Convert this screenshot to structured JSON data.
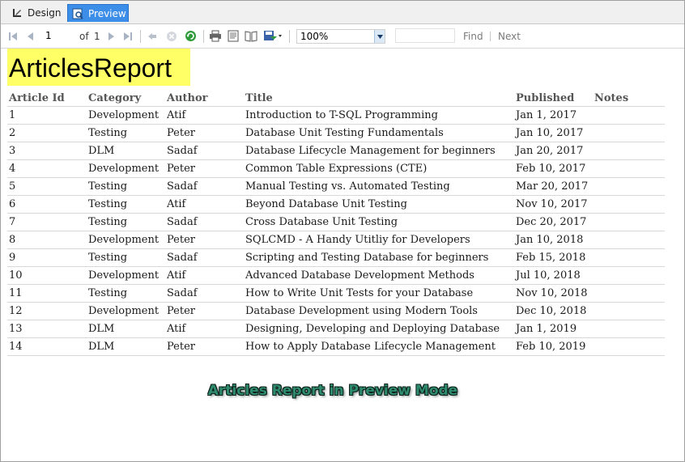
{
  "tabs": {
    "design_label": "Design",
    "preview_label": "Preview"
  },
  "toolbar": {
    "current_page": "1",
    "of_label": "of",
    "total_pages": "1",
    "zoom_value": "100%",
    "find_label": "Find",
    "next_label": "Next"
  },
  "report": {
    "title": "ArticlesReport",
    "columns": {
      "id": "Article Id",
      "category": "Category",
      "author": "Author",
      "title": "Title",
      "published": "Published",
      "notes": "Notes"
    },
    "rows": [
      {
        "id": "1",
        "category": "Development",
        "author": "Atif",
        "title": "Introduction to T-SQL Programming",
        "published": "Jan 1, 2017",
        "notes": ""
      },
      {
        "id": "2",
        "category": "Testing",
        "author": "Peter",
        "title": "Database Unit Testing Fundamentals",
        "published": "Jan 10, 2017",
        "notes": ""
      },
      {
        "id": "3",
        "category": "DLM",
        "author": "Sadaf",
        "title": "Database Lifecycle Management for beginners",
        "published": "Jan 20, 2017",
        "notes": ""
      },
      {
        "id": "4",
        "category": "Development",
        "author": "Peter",
        "title": "Common Table Expressions (CTE)",
        "published": "Feb 10, 2017",
        "notes": ""
      },
      {
        "id": "5",
        "category": "Testing",
        "author": "Sadaf",
        "title": "Manual Testing vs. Automated Testing",
        "published": "Mar 20, 2017",
        "notes": ""
      },
      {
        "id": "6",
        "category": "Testing",
        "author": "Atif",
        "title": "Beyond Database Unit Testing",
        "published": "Nov 10, 2017",
        "notes": ""
      },
      {
        "id": "7",
        "category": "Testing",
        "author": "Sadaf",
        "title": "Cross Database Unit Testing",
        "published": "Dec 20, 2017",
        "notes": ""
      },
      {
        "id": "8",
        "category": "Development",
        "author": "Peter",
        "title": "SQLCMD - A Handy Utitliy for Developers",
        "published": "Jan 10, 2018",
        "notes": ""
      },
      {
        "id": "9",
        "category": "Testing",
        "author": "Sadaf",
        "title": "Scripting and Testing Database for beginners",
        "published": "Feb 15, 2018",
        "notes": ""
      },
      {
        "id": "10",
        "category": "Development",
        "author": "Atif",
        "title": "Advanced Database Development Methods",
        "published": "Jul 10, 2018",
        "notes": ""
      },
      {
        "id": "11",
        "category": "Testing",
        "author": "Sadaf",
        "title": "How to Write Unit Tests for your Database",
        "published": "Nov 10, 2018",
        "notes": ""
      },
      {
        "id": "12",
        "category": "Development",
        "author": "Peter",
        "title": "Database Development using Modern Tools",
        "published": "Dec 10, 2018",
        "notes": ""
      },
      {
        "id": "13",
        "category": "DLM",
        "author": "Atif",
        "title": "Designing, Developing and Deploying Database",
        "published": "Jan 1, 2019",
        "notes": ""
      },
      {
        "id": "14",
        "category": "DLM",
        "author": "Peter",
        "title": "How to Apply Database Lifecycle Management",
        "published": "Feb 10, 2019",
        "notes": ""
      }
    ]
  },
  "caption": "Articles Report in Preview Mode",
  "colors": {
    "preview_tab": "#3c8ee8",
    "title_highlight": "#ffff66",
    "caption_fill": "#2e8b6e"
  },
  "icons": [
    "design-icon",
    "preview-icon",
    "first-page-icon",
    "prev-page-icon",
    "next-page-icon",
    "last-page-icon",
    "back-icon",
    "stop-icon",
    "refresh-icon",
    "print-icon",
    "print-layout-icon",
    "page-setup-icon",
    "export-icon",
    "dropdown-arrow-icon"
  ]
}
